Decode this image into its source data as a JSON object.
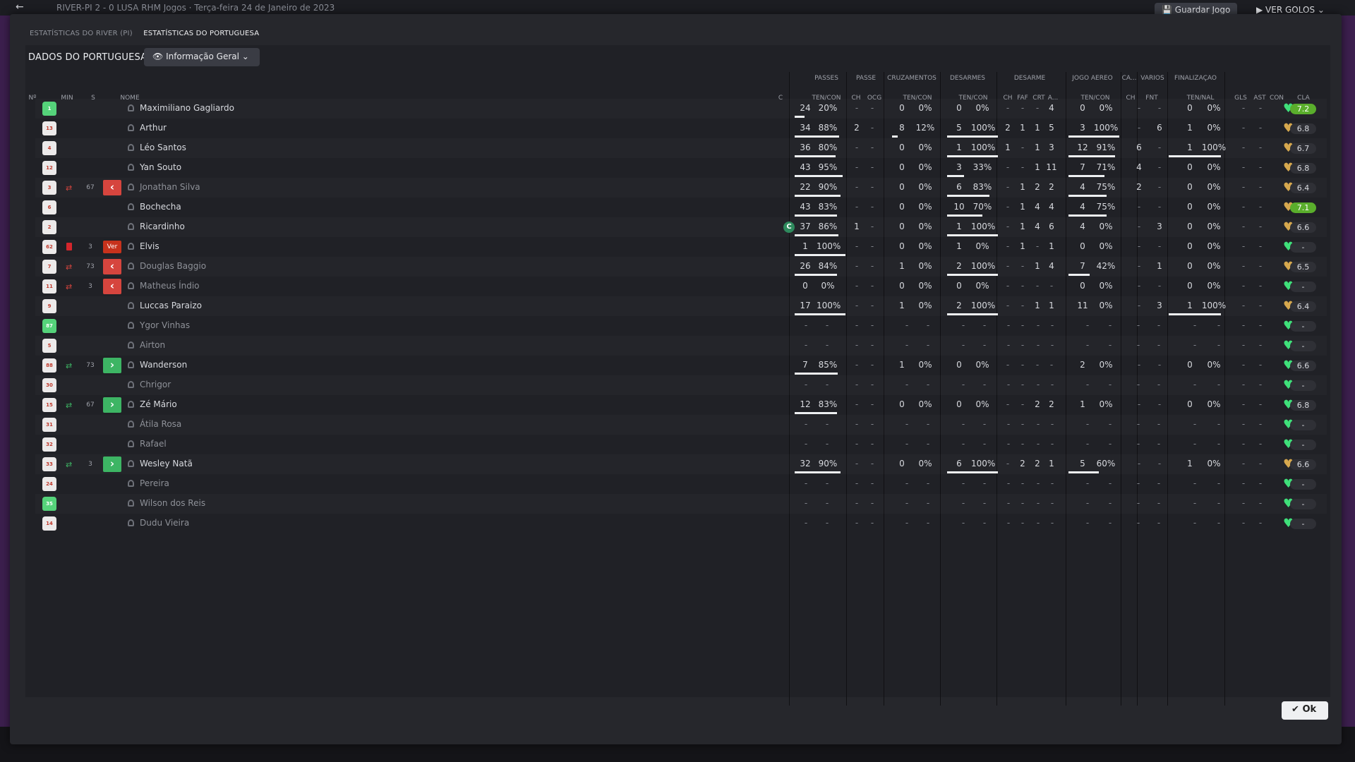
{
  "topbar": {
    "info": "RIVER-PI  2 - 0  LUSA   RHM Jogos  ·  Terça-feira 24 de Janeiro de 2023",
    "save_label": "Guardar Jogo",
    "goals_label": "VER GOLOS"
  },
  "tabs": [
    "ESTATÍSTICAS DO RIVER (PI)",
    "ESTATÍSTICAS DO PORTUGUESA"
  ],
  "section_title": "DADOS DO PORTUGUESA",
  "view_dropdown": {
    "label": "Informação Geral",
    "icon": "eye-icon"
  },
  "ok_label": "Ok",
  "colors": {
    "gk_shirt": "#55d37a",
    "accent_green": "#5aae2c",
    "sub_out": "#d6453e",
    "sub_in": "#3db564",
    "morale_green": "#3fe07a",
    "morale_gold": "#d6a84e"
  },
  "group_headers": [
    "PASSES",
    "PASSE",
    "CRUZAMENTOS",
    "DESARMES",
    "DESARME",
    "JOGO AÉREO",
    "CA...",
    "VÁRIOS",
    "FINALIZAÇÃO"
  ],
  "columns": [
    "Nº",
    "MIN",
    "S",
    "NOME",
    "C",
    "TEN/CON",
    "CH",
    "OCG",
    "TEN/CON",
    "TEN/CON",
    "CH",
    "FAF",
    "CRT",
    "A...",
    "TEN/CON",
    "CH",
    "FNT",
    "TEN/NAL",
    "GLS",
    "AST",
    "CON",
    "CLA"
  ],
  "players": [
    {
      "num": "1",
      "gk": true,
      "name": "Maximiliano Gagliardo",
      "pa": "24",
      "pp": "20%",
      "pf": 0.2,
      "pch": "-",
      "ocg": "-",
      "ca": "0",
      "cp": "0%",
      "cf": 0,
      "da": "0",
      "dp": "0%",
      "df": 0,
      "dch": "-",
      "faf": "-",
      "crt": "-",
      "dA": "4",
      "aa": "0",
      "ap": "0%",
      "af": 0,
      "cach": "-",
      "fnt": "-",
      "fa": "0",
      "fp": "0%",
      "ff": 0,
      "gls": "-",
      "ast": "-",
      "morale": "green",
      "rating": "7.2",
      "best": true
    },
    {
      "num": "13",
      "name": "Arthur",
      "pa": "34",
      "pp": "88%",
      "pf": 0.88,
      "pch": "2",
      "ocg": "-",
      "ca": "8",
      "cp": "12%",
      "cf": 0.12,
      "da": "5",
      "dp": "100%",
      "df": 1,
      "dch": "2",
      "faf": "1",
      "crt": "1",
      "dA": "5",
      "aa": "3",
      "ap": "100%",
      "af": 1,
      "cach": "-",
      "fnt": "6",
      "fa": "1",
      "fp": "0%",
      "ff": 0,
      "gls": "-",
      "ast": "-",
      "morale": "gold",
      "rating": "6.8"
    },
    {
      "num": "4",
      "name": "Léo Santos",
      "pa": "36",
      "pp": "80%",
      "pf": 0.8,
      "pch": "-",
      "ocg": "-",
      "ca": "0",
      "cp": "0%",
      "cf": 0,
      "da": "1",
      "dp": "100%",
      "df": 1,
      "dch": "1",
      "faf": "-",
      "crt": "1",
      "dA": "3",
      "aa": "12",
      "ap": "91%",
      "af": 0.91,
      "cach": "6",
      "fnt": "-",
      "fa": "1",
      "fp": "100%",
      "ff": 1,
      "gls": "-",
      "ast": "-",
      "morale": "gold",
      "rating": "6.7"
    },
    {
      "num": "12",
      "name": "Yan Souto",
      "pa": "43",
      "pp": "95%",
      "pf": 0.95,
      "pch": "-",
      "ocg": "-",
      "ca": "0",
      "cp": "0%",
      "cf": 0,
      "da": "3",
      "dp": "33%",
      "df": 0.33,
      "dch": "-",
      "faf": "-",
      "crt": "1",
      "dA": "11",
      "aa": "7",
      "ap": "71%",
      "af": 0.71,
      "cach": "4",
      "fnt": "-",
      "fa": "0",
      "fp": "0%",
      "ff": 0,
      "gls": "-",
      "ast": "-",
      "morale": "gold",
      "rating": "6.8"
    },
    {
      "num": "3",
      "name": "Jonathan Silva",
      "dim": true,
      "sub": "out",
      "min": "67",
      "pa": "22",
      "pp": "90%",
      "pf": 0.9,
      "pch": "-",
      "ocg": "-",
      "ca": "0",
      "cp": "0%",
      "cf": 0,
      "da": "6",
      "dp": "83%",
      "df": 0.83,
      "dch": "-",
      "faf": "1",
      "crt": "2",
      "dA": "2",
      "aa": "4",
      "ap": "75%",
      "af": 0.75,
      "cach": "2",
      "fnt": "-",
      "fa": "0",
      "fp": "0%",
      "ff": 0,
      "gls": "-",
      "ast": "-",
      "morale": "gold",
      "rating": "6.4"
    },
    {
      "num": "6",
      "name": "Bochecha",
      "pa": "43",
      "pp": "83%",
      "pf": 0.83,
      "pch": "-",
      "ocg": "-",
      "ca": "0",
      "cp": "0%",
      "cf": 0,
      "da": "10",
      "dp": "70%",
      "df": 0.7,
      "dch": "-",
      "faf": "1",
      "crt": "4",
      "dA": "4",
      "aa": "4",
      "ap": "75%",
      "af": 0.75,
      "cach": "-",
      "fnt": "-",
      "fa": "0",
      "fp": "0%",
      "ff": 0,
      "gls": "-",
      "ast": "-",
      "morale": "gold",
      "rating": "7.1",
      "best": true
    },
    {
      "num": "2",
      "name": "Ricardinho",
      "captain": true,
      "captain_label": "C",
      "pa": "37",
      "pp": "86%",
      "pf": 0.86,
      "pch": "1",
      "ocg": "-",
      "ca": "0",
      "cp": "0%",
      "cf": 0,
      "da": "1",
      "dp": "100%",
      "df": 1,
      "dch": "-",
      "faf": "1",
      "crt": "4",
      "dA": "6",
      "aa": "4",
      "ap": "0%",
      "af": 0,
      "cach": "-",
      "fnt": "3",
      "fa": "0",
      "fp": "0%",
      "ff": 0,
      "gls": "-",
      "ast": "-",
      "morale": "gold",
      "rating": "6.6"
    },
    {
      "num": "62",
      "name": "Elvis",
      "redcard": true,
      "min": "3",
      "ver_label": "Ver",
      "pa": "1",
      "pp": "100%",
      "pf": 1,
      "pch": "-",
      "ocg": "-",
      "ca": "0",
      "cp": "0%",
      "cf": 0,
      "da": "1",
      "dp": "0%",
      "df": 0,
      "dch": "-",
      "faf": "1",
      "crt": "-",
      "dA": "1",
      "aa": "0",
      "ap": "0%",
      "af": 0,
      "cach": "-",
      "fnt": "-",
      "fa": "0",
      "fp": "0%",
      "ff": 0,
      "gls": "-",
      "ast": "-",
      "morale": "green",
      "rating": "-"
    },
    {
      "num": "7",
      "name": "Douglas Baggio",
      "dim": true,
      "sub": "out",
      "min": "73",
      "pa": "26",
      "pp": "84%",
      "pf": 0.84,
      "pch": "-",
      "ocg": "-",
      "ca": "1",
      "cp": "0%",
      "cf": 0,
      "da": "2",
      "dp": "100%",
      "df": 1,
      "dch": "-",
      "faf": "-",
      "crt": "1",
      "dA": "4",
      "aa": "7",
      "ap": "42%",
      "af": 0.42,
      "cach": "-",
      "fnt": "1",
      "fa": "0",
      "fp": "0%",
      "ff": 0,
      "gls": "-",
      "ast": "-",
      "morale": "gold",
      "rating": "6.5"
    },
    {
      "num": "11",
      "name": "Matheus Índio",
      "dim": true,
      "sub": "out",
      "min": "3",
      "pa": "0",
      "pp": "0%",
      "pf": 0,
      "pch": "-",
      "ocg": "-",
      "ca": "0",
      "cp": "0%",
      "cf": 0,
      "da": "0",
      "dp": "0%",
      "df": 0,
      "dch": "-",
      "faf": "-",
      "crt": "-",
      "dA": "-",
      "aa": "0",
      "ap": "0%",
      "af": 0,
      "cach": "-",
      "fnt": "-",
      "fa": "0",
      "fp": "0%",
      "ff": 0,
      "gls": "-",
      "ast": "-",
      "morale": "green",
      "rating": "-"
    },
    {
      "num": "9",
      "name": "Luccas Paraizo",
      "pa": "17",
      "pp": "100%",
      "pf": 1,
      "pch": "-",
      "ocg": "-",
      "ca": "1",
      "cp": "0%",
      "cf": 0,
      "da": "2",
      "dp": "100%",
      "df": 1,
      "dch": "-",
      "faf": "-",
      "crt": "1",
      "dA": "1",
      "aa": "11",
      "ap": "0%",
      "af": 0,
      "cach": "-",
      "fnt": "3",
      "fa": "1",
      "fp": "100%",
      "ff": 1,
      "gls": "-",
      "ast": "-",
      "morale": "gold",
      "rating": "6.4"
    },
    {
      "num": "87",
      "gk": true,
      "name": "Ygor Vinhas",
      "dim": true,
      "unused": true,
      "morale": "green",
      "rating": "-"
    },
    {
      "num": "5",
      "name": "Airton",
      "dim": true,
      "unused": true,
      "morale": "green",
      "rating": "-"
    },
    {
      "num": "88",
      "name": "Wanderson",
      "sub": "in",
      "min": "73",
      "pa": "7",
      "pp": "85%",
      "pf": 0.85,
      "pch": "-",
      "ocg": "-",
      "ca": "1",
      "cp": "0%",
      "cf": 0,
      "da": "0",
      "dp": "0%",
      "df": 0,
      "dch": "-",
      "faf": "-",
      "crt": "-",
      "dA": "-",
      "aa": "2",
      "ap": "0%",
      "af": 0,
      "cach": "-",
      "fnt": "-",
      "fa": "0",
      "fp": "0%",
      "ff": 0,
      "gls": "-",
      "ast": "-",
      "morale": "green",
      "rating": "6.6"
    },
    {
      "num": "30",
      "name": "Chrigor",
      "dim": true,
      "unused": true,
      "morale": "green",
      "rating": "-"
    },
    {
      "num": "15",
      "name": "Zé Mário",
      "sub": "in",
      "min": "67",
      "pa": "12",
      "pp": "83%",
      "pf": 0.83,
      "pch": "-",
      "ocg": "-",
      "ca": "0",
      "cp": "0%",
      "cf": 0,
      "da": "0",
      "dp": "0%",
      "df": 0,
      "dch": "-",
      "faf": "-",
      "crt": "2",
      "dA": "2",
      "aa": "1",
      "ap": "0%",
      "af": 0,
      "cach": "-",
      "fnt": "-",
      "fa": "0",
      "fp": "0%",
      "ff": 0,
      "gls": "-",
      "ast": "-",
      "morale": "green",
      "rating": "6.8"
    },
    {
      "num": "31",
      "name": "Átila Rosa",
      "dim": true,
      "unused": true,
      "morale": "green",
      "rating": "-"
    },
    {
      "num": "32",
      "name": "Rafael",
      "dim": true,
      "unused": true,
      "morale": "green",
      "rating": "-"
    },
    {
      "num": "33",
      "name": "Wesley Natã",
      "sub": "in",
      "min": "3",
      "pa": "32",
      "pp": "90%",
      "pf": 0.9,
      "pch": "-",
      "ocg": "-",
      "ca": "0",
      "cp": "0%",
      "cf": 0,
      "da": "6",
      "dp": "100%",
      "df": 1,
      "dch": "-",
      "faf": "2",
      "crt": "2",
      "dA": "1",
      "aa": "5",
      "ap": "60%",
      "af": 0.6,
      "cach": "-",
      "fnt": "-",
      "fa": "1",
      "fp": "0%",
      "ff": 0,
      "gls": "-",
      "ast": "-",
      "morale": "gold",
      "rating": "6.6"
    },
    {
      "num": "24",
      "name": "Pereira",
      "dim": true,
      "unused": true,
      "morale": "green",
      "rating": "-"
    },
    {
      "num": "35",
      "gk": true,
      "name": "Wilson dos Reis",
      "dim": true,
      "unused": true,
      "morale": "green",
      "rating": "-"
    },
    {
      "num": "14",
      "name": "Dudu Vieira",
      "dim": true,
      "unused": true,
      "morale": "green",
      "rating": "-"
    }
  ]
}
